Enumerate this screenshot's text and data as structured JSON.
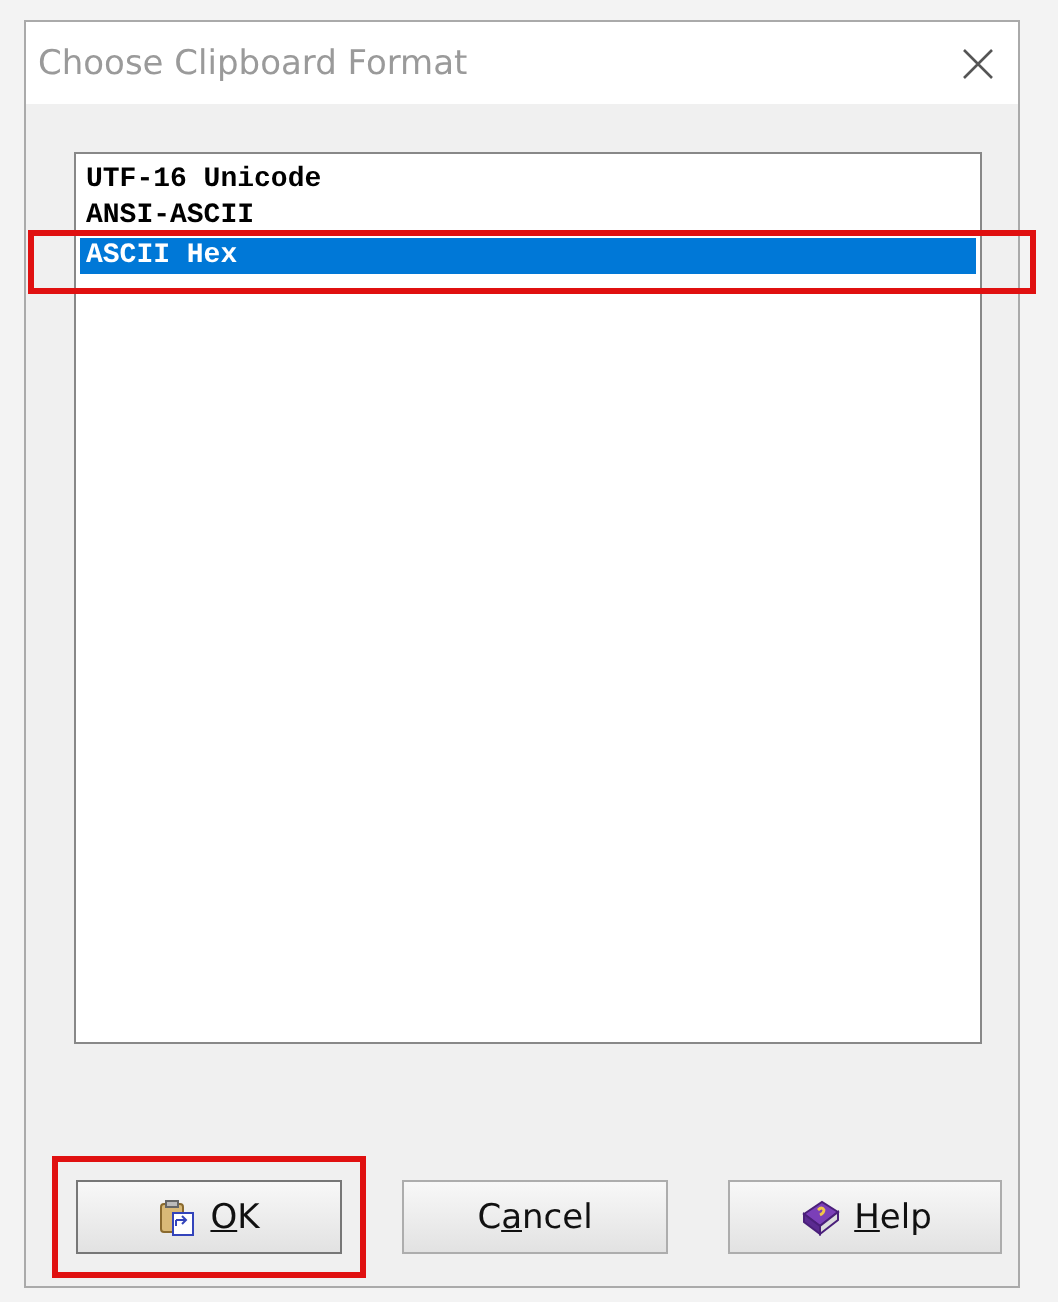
{
  "window": {
    "title": "Choose Clipboard Format"
  },
  "formats": [
    {
      "label": "UTF-16 Unicode",
      "selected": false,
      "highlighted": false
    },
    {
      "label": "ANSI-ASCII",
      "selected": false,
      "highlighted": false
    },
    {
      "label": "ASCII Hex",
      "selected": true,
      "highlighted": true
    }
  ],
  "buttons": [
    {
      "kind": "ok",
      "key": "O",
      "post": "K",
      "highlighted": true
    },
    {
      "kind": "cancel",
      "pre": "C",
      "key": "a",
      "post": "ncel",
      "highlighted": false
    },
    {
      "kind": "help",
      "key": "H",
      "post": "elp",
      "highlighted": false
    }
  ]
}
